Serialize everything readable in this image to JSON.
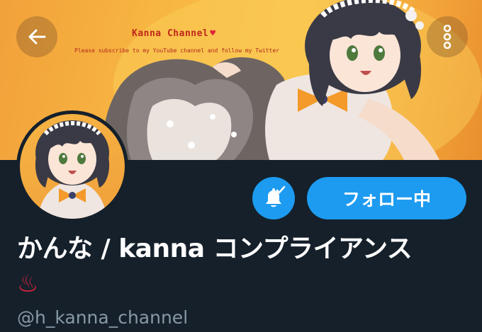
{
  "banner": {
    "title": "Kanna Channel",
    "heart": "♥",
    "subtitle": "Please subscribe to my YouTube channel and follow my Twitter"
  },
  "header": {
    "back_icon": "arrow-left-icon",
    "more_icon": "more-vertical-icon"
  },
  "profile": {
    "display_name": "かんな / kanna コンプライアンス",
    "emoji": "♨",
    "handle": "@h_kanna_channel",
    "follow_label": "フォロー中",
    "notification_icon": "bell-check-icon"
  },
  "colors": {
    "background": "#15202b",
    "accent": "#1d9bf0",
    "banner_text": "#c0271b",
    "handle_text": "#8899a6",
    "emoji": "#e0243a"
  }
}
